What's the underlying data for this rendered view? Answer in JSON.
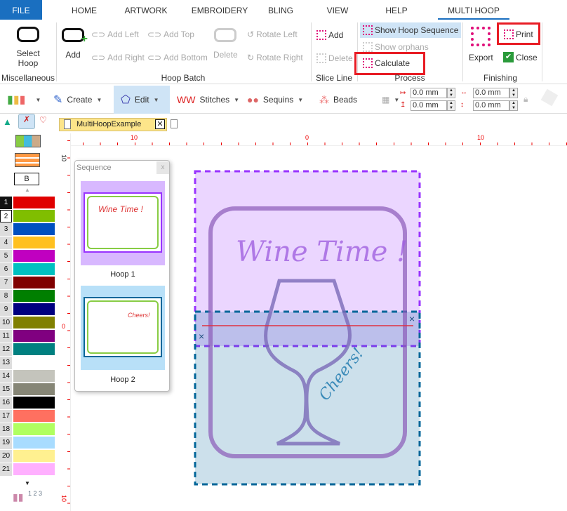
{
  "tabs": {
    "file": "FILE",
    "home": "HOME",
    "artwork": "ARTWORK",
    "embroidery": "EMBROIDERY",
    "bling": "BLING",
    "view": "VIEW",
    "help": "HELP",
    "multihoop": "MULTI HOOP",
    "active": "MULTI HOOP"
  },
  "ribbon": {
    "miscellaneous": {
      "label": "Miscellaneous",
      "select_hoop": "Select Hoop"
    },
    "hoop_batch": {
      "label": "Hoop Batch",
      "add": "Add",
      "add_left": "Add Left",
      "add_right": "Add Right",
      "add_top": "Add Top",
      "add_bottom": "Add Bottom",
      "delete": "Delete",
      "rotate_left": "Rotate Left",
      "rotate_right": "Rotate Right"
    },
    "slice_line": {
      "label": "Slice Line",
      "add": "Add",
      "delete": "Delete"
    },
    "process": {
      "label": "Process",
      "show_hoop_sequence": "Show Hoop Sequence",
      "show_orphans": "Show orphans",
      "calculate": "Calculate"
    },
    "finishing": {
      "label": "Finishing",
      "export": "Export",
      "print": "Print",
      "close": "Close"
    }
  },
  "toolbar": {
    "create": "Create",
    "edit": "Edit",
    "stitches": "Stitches",
    "sequins": "Sequins",
    "beads": "Beads",
    "x": "0.0 mm",
    "y": "0.0 mm",
    "w": "0.0 mm",
    "h": "0.0 mm"
  },
  "left_panel": {
    "letter": "B",
    "palette": [
      {
        "n": "1",
        "c": "#e00000"
      },
      {
        "n": "2",
        "c": "#80be00"
      },
      {
        "n": "3",
        "c": "#0050c0"
      },
      {
        "n": "4",
        "c": "#ffc020"
      },
      {
        "n": "5",
        "c": "#c000c0"
      },
      {
        "n": "6",
        "c": "#00c0c0"
      },
      {
        "n": "7",
        "c": "#800000"
      },
      {
        "n": "8",
        "c": "#007f00"
      },
      {
        "n": "9",
        "c": "#000080"
      },
      {
        "n": "10",
        "c": "#808000"
      },
      {
        "n": "11",
        "c": "#800080"
      },
      {
        "n": "12",
        "c": "#008080"
      },
      {
        "n": "13",
        "c": "#ffffff"
      },
      {
        "n": "14",
        "c": "#c4c4bc"
      },
      {
        "n": "15",
        "c": "#868676"
      },
      {
        "n": "16",
        "c": "#000000"
      },
      {
        "n": "17",
        "c": "#ff7060"
      },
      {
        "n": "18",
        "c": "#b0ff60"
      },
      {
        "n": "19",
        "c": "#a8dcff"
      },
      {
        "n": "20",
        "c": "#fff090"
      },
      {
        "n": "21",
        "c": "#ffb0ff"
      }
    ],
    "sequence_label": "1 2 3"
  },
  "document": {
    "tab": "MultiHoopExample",
    "unit": "cm",
    "ruler_top": [
      "10",
      "0",
      "10"
    ],
    "ruler_left": [
      "10",
      "0",
      "10"
    ]
  },
  "sequence_panel": {
    "title": "Sequence",
    "close": "x",
    "hoops": [
      {
        "label": "Hoop 1",
        "bg": "#d8b8ff"
      },
      {
        "label": "Hoop 2",
        "bg": "#b8e0f8"
      }
    ]
  },
  "design": {
    "text1": "Wine Time !",
    "text2": "Cheers!",
    "hoop1_color": "#9933ff",
    "hoop2_color": "#006699",
    "slice_color": "#e03040"
  }
}
